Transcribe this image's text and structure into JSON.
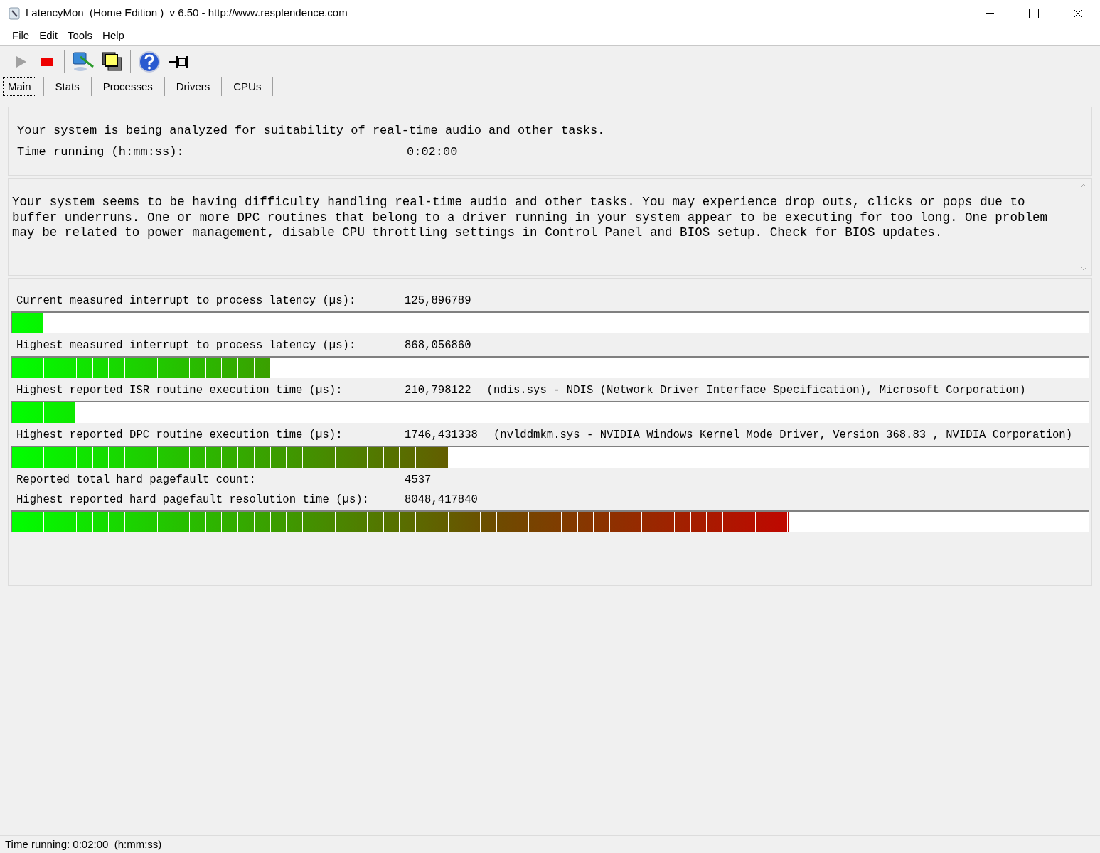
{
  "window": {
    "title": "LatencyMon  (Home Edition )  v 6.50 - http://www.resplendence.com"
  },
  "menu": [
    "File",
    "Edit",
    "Tools",
    "Help"
  ],
  "toolbar": [
    {
      "kind": "play",
      "disabled": true
    },
    {
      "kind": "stop",
      "disabled": false
    },
    {
      "kind": "sep"
    },
    {
      "kind": "monitor"
    },
    {
      "kind": "windows"
    },
    {
      "kind": "sep"
    },
    {
      "kind": "help"
    },
    {
      "kind": "pin"
    }
  ],
  "tabs": [
    {
      "label": "Main",
      "selected": true
    },
    {
      "label": "Stats",
      "selected": false
    },
    {
      "label": "Processes",
      "selected": false
    },
    {
      "label": "Drivers",
      "selected": false
    },
    {
      "label": "CPUs",
      "selected": false
    }
  ],
  "status_panel": {
    "message": "Your system is being analyzed for suitability of real-time audio and other tasks.",
    "time_label": "Time running (h:mm:ss):",
    "time_value": "0:02:00"
  },
  "conclusion": "Your system seems to be having difficulty handling real-time audio and other tasks. You may experience drop outs, clicks or pops due to buffer underruns. One or more DPC routines that belong to a driver running in your system appear to be executing for too long. One problem may be related to power management, disable CPU throttling settings in Control Panel and BIOS setup. Check for BIOS updates.",
  "measurements": [
    {
      "label": "Current measured interrupt to process latency (µs):",
      "value": "125,896789",
      "level": 0.029
    },
    {
      "label": "Highest measured interrupt to process latency (µs):",
      "value": "868,056860",
      "level": 0.24
    },
    {
      "label": "Highest reported ISR routine execution time (µs):",
      "value": "210,798122",
      "detail": "(ndis.sys - NDIS (Network Driver Interface Specification), Microsoft Corporation)",
      "level": 0.059
    },
    {
      "label": "Highest reported DPC routine execution time (µs):",
      "value": "1746,431338",
      "detail": "(nvlddmkm.sys - NVIDIA Windows Kernel Mode Driver, Version 368.83 , NVIDIA Corporation)",
      "level": 0.405
    },
    {
      "label": "Reported total hard pagefault count:",
      "value": "4537"
    },
    {
      "label": "Highest reported hard pagefault resolution time (µs):",
      "value": "8048,417840",
      "level": 0.722
    }
  ],
  "status_bar": "Time running: 0:02:00  (h:mm:ss)"
}
